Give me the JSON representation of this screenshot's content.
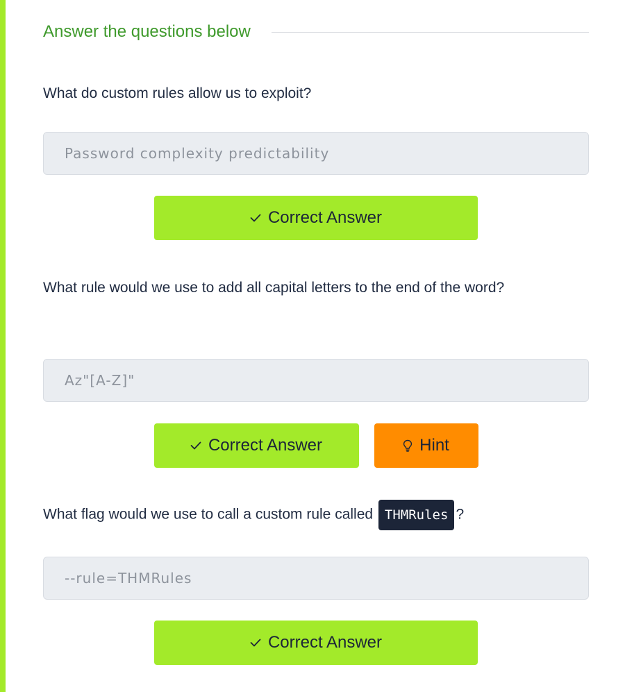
{
  "section": {
    "title": "Answer the questions below"
  },
  "questions": [
    {
      "text": "What do custom rules allow us to exploit?",
      "answer": "Password complexity predictability",
      "button_label": "Correct Answer"
    },
    {
      "text": "What rule would we use to add all capital letters to the end of the word?",
      "answer": "Az\"[A-Z]\"",
      "button_label": "Correct Answer",
      "hint_label": "Hint"
    },
    {
      "text_before": "What flag would we use to call a custom rule called",
      "code": "THMRules",
      "text_after": "?",
      "answer": "--rule=THMRules",
      "button_label": "Correct Answer"
    }
  ],
  "colors": {
    "accent_green": "#a3ea2a",
    "title_green": "#3f9a2c",
    "hint_orange": "#ff8c00",
    "dark_navy": "#1c2538"
  },
  "icons": {
    "correct": "check-icon",
    "hint": "lightbulb-icon"
  }
}
